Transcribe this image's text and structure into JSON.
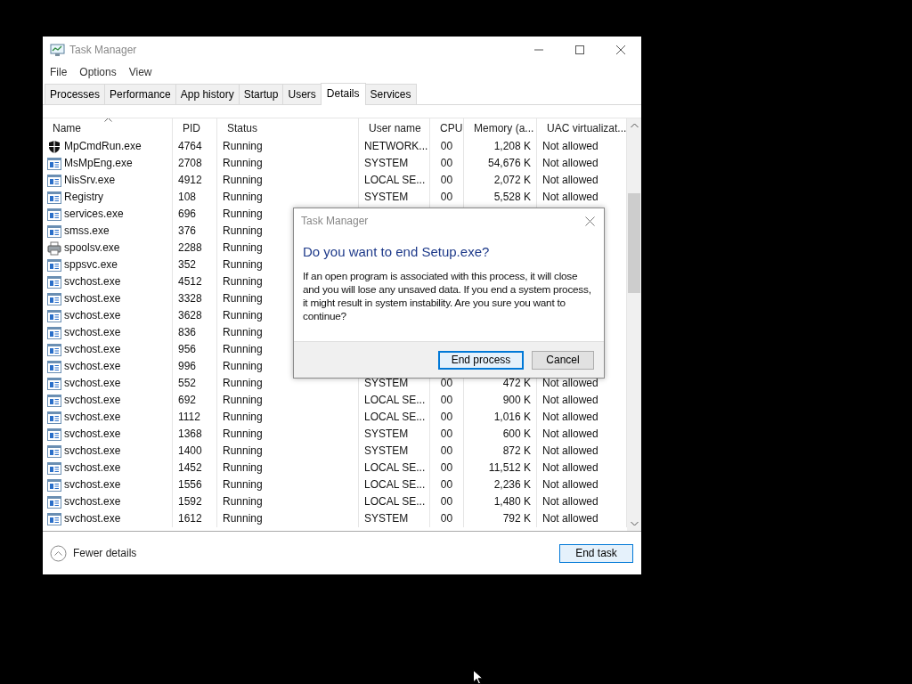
{
  "window": {
    "title": "Task Manager"
  },
  "menu": [
    "File",
    "Options",
    "View"
  ],
  "tabs": [
    {
      "label": "Processes",
      "selected": false
    },
    {
      "label": "Performance",
      "selected": false
    },
    {
      "label": "App history",
      "selected": false
    },
    {
      "label": "Startup",
      "selected": false
    },
    {
      "label": "Users",
      "selected": false
    },
    {
      "label": "Details",
      "selected": true
    },
    {
      "label": "Services",
      "selected": false
    }
  ],
  "table": {
    "columns": [
      {
        "label": "Name",
        "sorted": true
      },
      {
        "label": "PID",
        "sorted": false
      },
      {
        "label": "Status",
        "sorted": false
      },
      {
        "label": "User name",
        "sorted": false
      },
      {
        "label": "CPU",
        "sorted": false
      },
      {
        "label": "Memory (a...",
        "sorted": false
      },
      {
        "label": "UAC virtualizat...",
        "sorted": false
      }
    ],
    "rows": [
      {
        "kind": "shield",
        "name": "MpCmdRun.exe",
        "pid": "4764",
        "status": "Running",
        "user": "NETWORK...",
        "cpu": "00",
        "memory": "1,208 K",
        "uac": "Not allowed"
      },
      {
        "kind": "app",
        "name": "MsMpEng.exe",
        "pid": "2708",
        "status": "Running",
        "user": "SYSTEM",
        "cpu": "00",
        "memory": "54,676 K",
        "uac": "Not allowed"
      },
      {
        "kind": "app",
        "name": "NisSrv.exe",
        "pid": "4912",
        "status": "Running",
        "user": "LOCAL SE...",
        "cpu": "00",
        "memory": "2,072 K",
        "uac": "Not allowed"
      },
      {
        "kind": "app",
        "name": "Registry",
        "pid": "108",
        "status": "Running",
        "user": "SYSTEM",
        "cpu": "00",
        "memory": "5,528 K",
        "uac": "Not allowed"
      },
      {
        "kind": "app",
        "name": "services.exe",
        "pid": "696",
        "status": "Running"
      },
      {
        "kind": "app",
        "name": "smss.exe",
        "pid": "376",
        "status": "Running"
      },
      {
        "kind": "printer",
        "name": "spoolsv.exe",
        "pid": "2288",
        "status": "Running"
      },
      {
        "kind": "app",
        "name": "sppsvc.exe",
        "pid": "352",
        "status": "Running"
      },
      {
        "kind": "app",
        "name": "svchost.exe",
        "pid": "4512",
        "status": "Running"
      },
      {
        "kind": "app",
        "name": "svchost.exe",
        "pid": "3328",
        "status": "Running"
      },
      {
        "kind": "app",
        "name": "svchost.exe",
        "pid": "3628",
        "status": "Running"
      },
      {
        "kind": "app",
        "name": "svchost.exe",
        "pid": "836",
        "status": "Running"
      },
      {
        "kind": "app",
        "name": "svchost.exe",
        "pid": "956",
        "status": "Running"
      },
      {
        "kind": "app",
        "name": "svchost.exe",
        "pid": "996",
        "status": "Running"
      },
      {
        "kind": "app",
        "name": "svchost.exe",
        "pid": "552",
        "status": "Running",
        "user": "SYSTEM",
        "cpu": "00",
        "memory": "472 K",
        "uac": "Not allowed"
      },
      {
        "kind": "app",
        "name": "svchost.exe",
        "pid": "692",
        "status": "Running",
        "user": "LOCAL SE...",
        "cpu": "00",
        "memory": "900 K",
        "uac": "Not allowed"
      },
      {
        "kind": "app",
        "name": "svchost.exe",
        "pid": "1112",
        "status": "Running",
        "user": "LOCAL SE...",
        "cpu": "00",
        "memory": "1,016 K",
        "uac": "Not allowed"
      },
      {
        "kind": "app",
        "name": "svchost.exe",
        "pid": "1368",
        "status": "Running",
        "user": "SYSTEM",
        "cpu": "00",
        "memory": "600 K",
        "uac": "Not allowed"
      },
      {
        "kind": "app",
        "name": "svchost.exe",
        "pid": "1400",
        "status": "Running",
        "user": "SYSTEM",
        "cpu": "00",
        "memory": "872 K",
        "uac": "Not allowed"
      },
      {
        "kind": "app",
        "name": "svchost.exe",
        "pid": "1452",
        "status": "Running",
        "user": "LOCAL SE...",
        "cpu": "00",
        "memory": "11,512 K",
        "uac": "Not allowed"
      },
      {
        "kind": "app",
        "name": "svchost.exe",
        "pid": "1556",
        "status": "Running",
        "user": "LOCAL SE...",
        "cpu": "00",
        "memory": "2,236 K",
        "uac": "Not allowed"
      },
      {
        "kind": "app",
        "name": "svchost.exe",
        "pid": "1592",
        "status": "Running",
        "user": "LOCAL SE...",
        "cpu": "00",
        "memory": "1,480 K",
        "uac": "Not allowed"
      },
      {
        "kind": "app",
        "name": "svchost.exe",
        "pid": "1612",
        "status": "Running",
        "user": "SYSTEM",
        "cpu": "00",
        "memory": "792 K",
        "uac": "Not allowed"
      }
    ]
  },
  "footer": {
    "fewer_details": "Fewer details",
    "end_task": "End task"
  },
  "dialog": {
    "title": "Task Manager",
    "heading": "Do you want to end Setup.exe?",
    "message": "If an open program is associated with this process, it will close and you will lose any unsaved data. If you end a system process, it might result in system instability. Are you sure you want to continue?",
    "buttons": [
      {
        "label": "End process",
        "default": true
      },
      {
        "label": "Cancel",
        "default": false
      }
    ]
  }
}
